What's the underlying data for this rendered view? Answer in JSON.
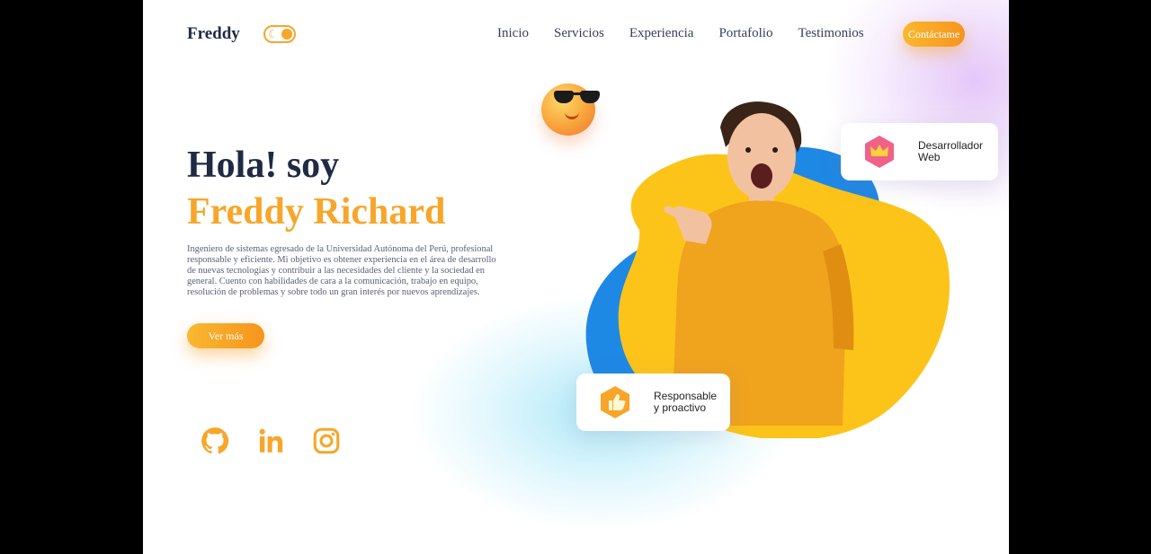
{
  "header": {
    "brand": "Freddy",
    "nav": [
      "Inicio",
      "Servicios",
      "Experiencia",
      "Portafolio",
      "Testimonios"
    ],
    "contact_label": "Contáctame"
  },
  "hero": {
    "greeting": "Hola! soy",
    "name": "Freddy Richard",
    "bio": "Ingeniero de sistemas egresado de la Universidad Autónoma del Perú, profesional responsable y eficiente. Mi objetivo es obtener experiencia en el área de desarrollo de nuevas tecnologías y contribuir a las necesidades del cliente y la sociedad en general. Cuento con habilidades de cara a la comunicación, trabajo en equipo, resolución de problemas y sobre todo un gran interés por nuevos aprendizajes.",
    "more_label": "Ver más"
  },
  "cards": {
    "web": {
      "line1": "Desarrollador",
      "line2": "Web",
      "icon": "crown-icon"
    },
    "resp": {
      "line1": "Responsable",
      "line2": "y proactivo",
      "icon": "thumbs-up-icon"
    }
  },
  "socials": [
    "github-icon",
    "linkedin-icon",
    "instagram-icon"
  ],
  "colors": {
    "accent": "#f7a62a",
    "dark": "#1f2a44",
    "blob_yellow": "#fcc419",
    "blob_blue": "#1e88e5"
  }
}
